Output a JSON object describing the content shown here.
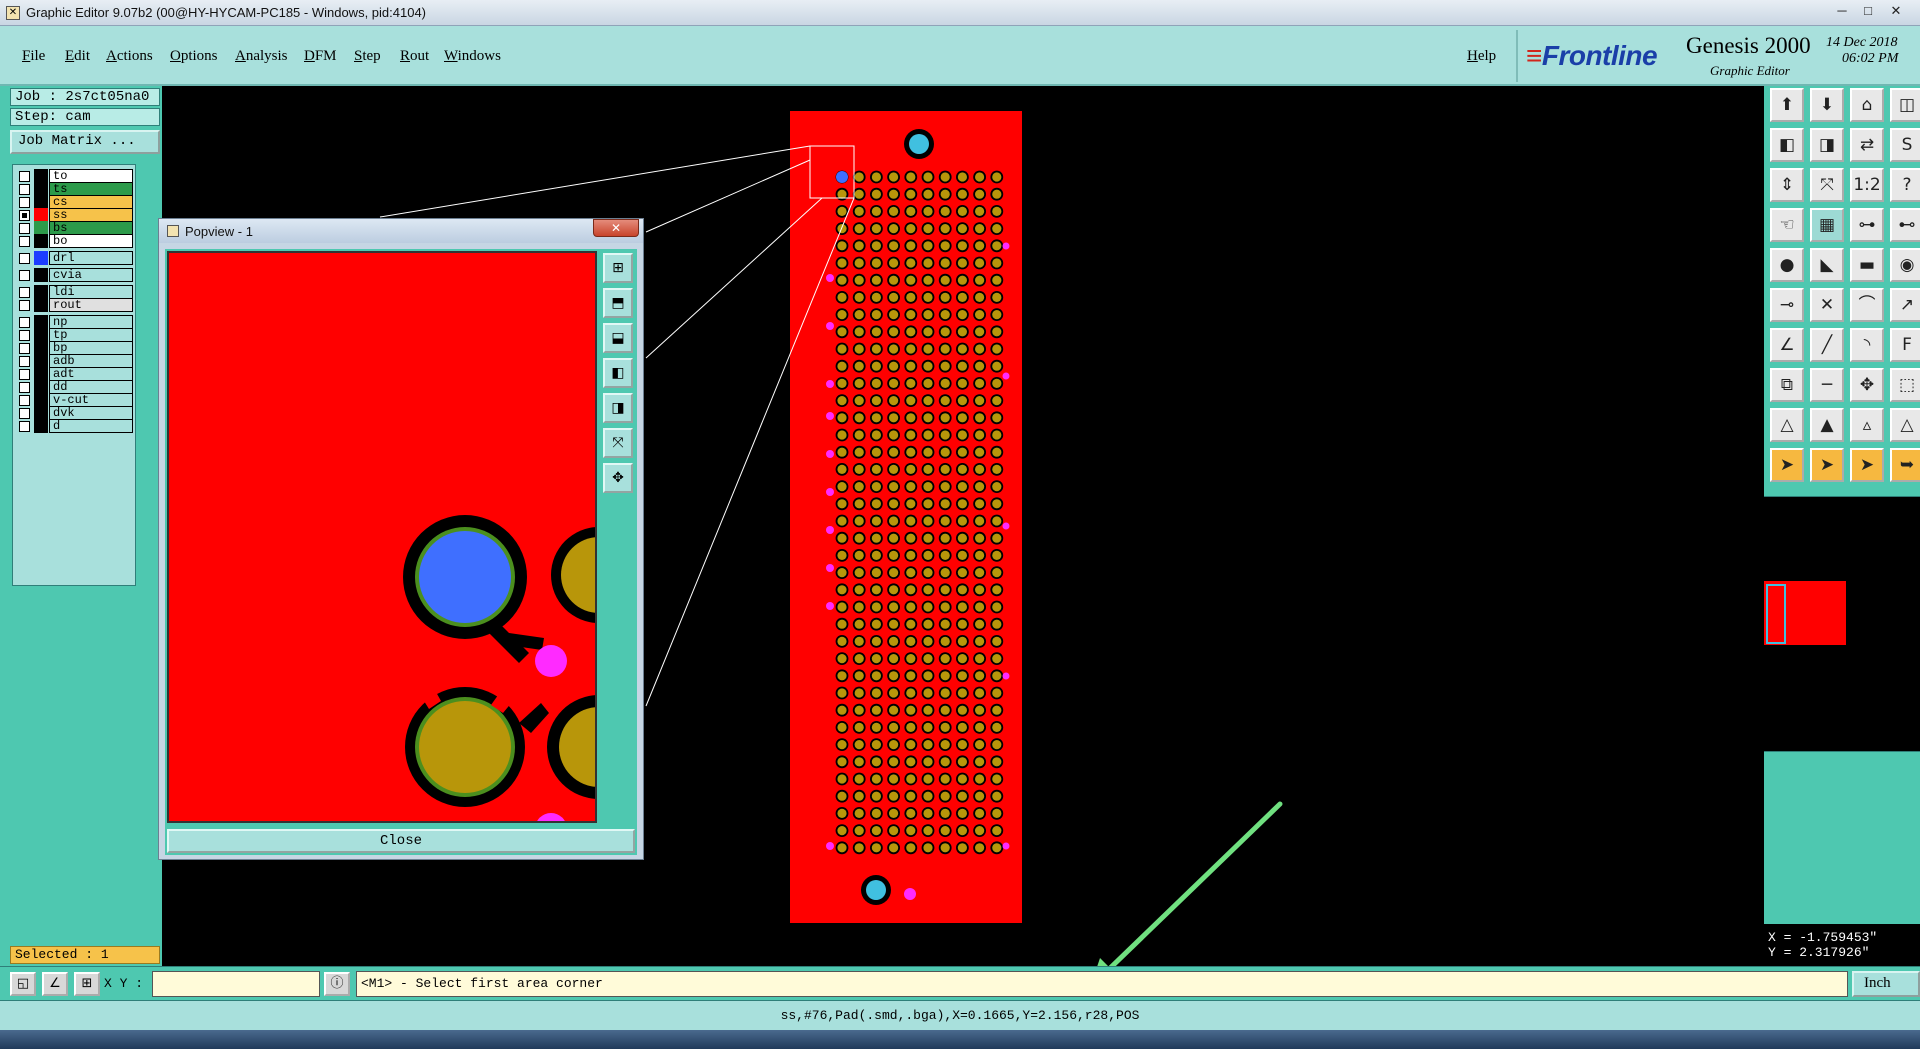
{
  "window": {
    "title": "Graphic Editor 9.07b2 (00@HY-HYCAM-PC185 - Windows, pid:4104)",
    "minimize": "─",
    "maximize": "□",
    "close": "✕"
  },
  "menu": {
    "items": [
      "File",
      "Edit",
      "Actions",
      "Options",
      "Analysis",
      "DFM",
      "Step",
      "Rout",
      "Windows"
    ],
    "help": "Help"
  },
  "brand": {
    "logo": "Frontline",
    "product": "Genesis 2000",
    "subtitle": "Graphic Editor",
    "date": "14 Dec 2018",
    "time": "06:02 PM"
  },
  "job": {
    "job_label": "Job : 2s7ct05na0",
    "step_label": "Step: cam",
    "matrix_button": "Job Matrix ..."
  },
  "layers": [
    {
      "name": "to",
      "color": "#ffffff",
      "checked": false,
      "swatch": "#000000"
    },
    {
      "name": "ts",
      "color": "#2c9a4a",
      "checked": false,
      "swatch": "#000000"
    },
    {
      "name": "cs",
      "color": "#f6c24a",
      "checked": false,
      "swatch": "#000000"
    },
    {
      "name": "ss",
      "color": "#f6c24a",
      "checked": true,
      "swatch": "#ff0000",
      "work": true
    },
    {
      "name": "bs",
      "color": "#2c9a4a",
      "checked": false,
      "swatch": "#2c9a4a"
    },
    {
      "name": "bo",
      "color": "#ffffff",
      "checked": false,
      "swatch": "#000000"
    },
    {
      "name": "drl",
      "color": "#a8e0dc",
      "checked": false,
      "swatch": "#1c3cff"
    },
    {
      "name": "cvia",
      "color": "#a8e0dc",
      "checked": false,
      "swatch": "#000000"
    },
    {
      "name": "ldi",
      "color": "#a8e0dc",
      "checked": false,
      "swatch": "#000000"
    },
    {
      "name": "rout",
      "color": "#e0e0e0",
      "checked": false,
      "swatch": "#000000"
    },
    {
      "name": "np",
      "color": "#a8e0dc",
      "checked": false,
      "swatch": "#000000"
    },
    {
      "name": "tp",
      "color": "#a8e0dc",
      "checked": false,
      "swatch": "#000000"
    },
    {
      "name": "bp",
      "color": "#a8e0dc",
      "checked": false,
      "swatch": "#000000"
    },
    {
      "name": "adb",
      "color": "#a8e0dc",
      "checked": false,
      "swatch": "#000000"
    },
    {
      "name": "adt",
      "color": "#a8e0dc",
      "checked": false,
      "swatch": "#000000"
    },
    {
      "name": "dd",
      "color": "#a8e0dc",
      "checked": false,
      "swatch": "#000000"
    },
    {
      "name": "v-cut",
      "color": "#a8e0dc",
      "checked": false,
      "swatch": "#000000"
    },
    {
      "name": "dvk",
      "color": "#a8e0dc",
      "checked": false,
      "swatch": "#000000"
    },
    {
      "name": "d",
      "color": "#a8e0dc",
      "checked": false,
      "swatch": "#000000"
    }
  ],
  "selected_status": "Selected : 1",
  "popview": {
    "title": "Popview - 1",
    "close_label": "Close",
    "close_x": "✕"
  },
  "coords": {
    "x": "X = -1.759453\"",
    "y": "Y = 2.317926\""
  },
  "command": {
    "xy_label": "X Y :",
    "xy_value": "",
    "prompt": "<M1> - Select first area corner",
    "units": "Inch"
  },
  "status_line": "ss,#76,Pad(.smd,.bga),X=0.1665,Y=2.156,r28,POS",
  "colors": {
    "board": "#ff0000",
    "pad": "#b8960a",
    "pad_ring": "#4b8f1e",
    "via": "#ff2aff",
    "hole": "#3f6fff",
    "fiducial": "#40c0e0",
    "panel": "#4ec8b0",
    "menu": "#a8e0dc"
  }
}
